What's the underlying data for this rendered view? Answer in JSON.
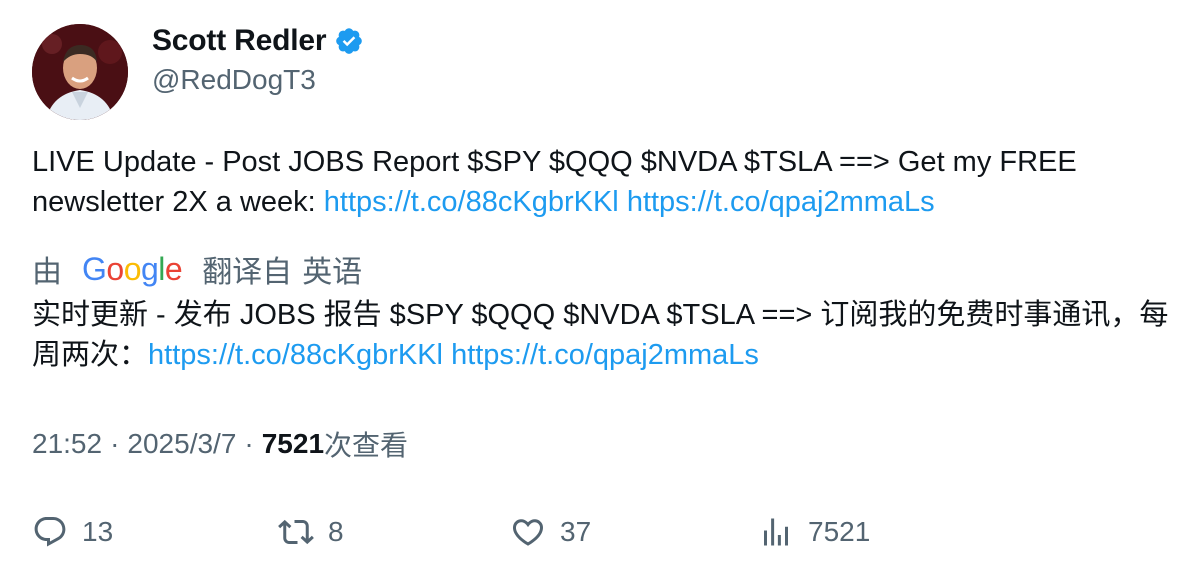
{
  "author": {
    "name": "Scott Redler",
    "handle": "@RedDogT3",
    "verified_icon": "verified-badge-icon",
    "avatar_icon": "avatar-photo"
  },
  "tweet": {
    "text": "LIVE Update - Post JOBS Report $SPY $QQQ $NVDA $TSLA ==> Get my FREE newsletter 2X a week: ",
    "link1": "https://t.co/88cKgbrKKl",
    "link2": "https://t.co/qpaj2mmaLs"
  },
  "translation": {
    "by_label": "由",
    "provider": "Google",
    "from_label": "翻译自",
    "language": "英语",
    "text": "实时更新 - 发布 JOBS 报告 $SPY $QQQ $NVDA $TSLA ==> 订阅我的免费时事通讯，每周两次：",
    "link1": "https://t.co/88cKgbrKKl",
    "link2": "https://t.co/qpaj2mmaLs"
  },
  "meta": {
    "time": "21:52",
    "separator": "·",
    "date": "2025/3/7",
    "views_count": "7521",
    "views_label": "次查看"
  },
  "actions": {
    "replies": "13",
    "retweets": "8",
    "likes": "37",
    "views": "7521"
  },
  "colors": {
    "link": "#1d9bf0",
    "secondary_text": "#536471",
    "verified": "#1d9bf0"
  }
}
